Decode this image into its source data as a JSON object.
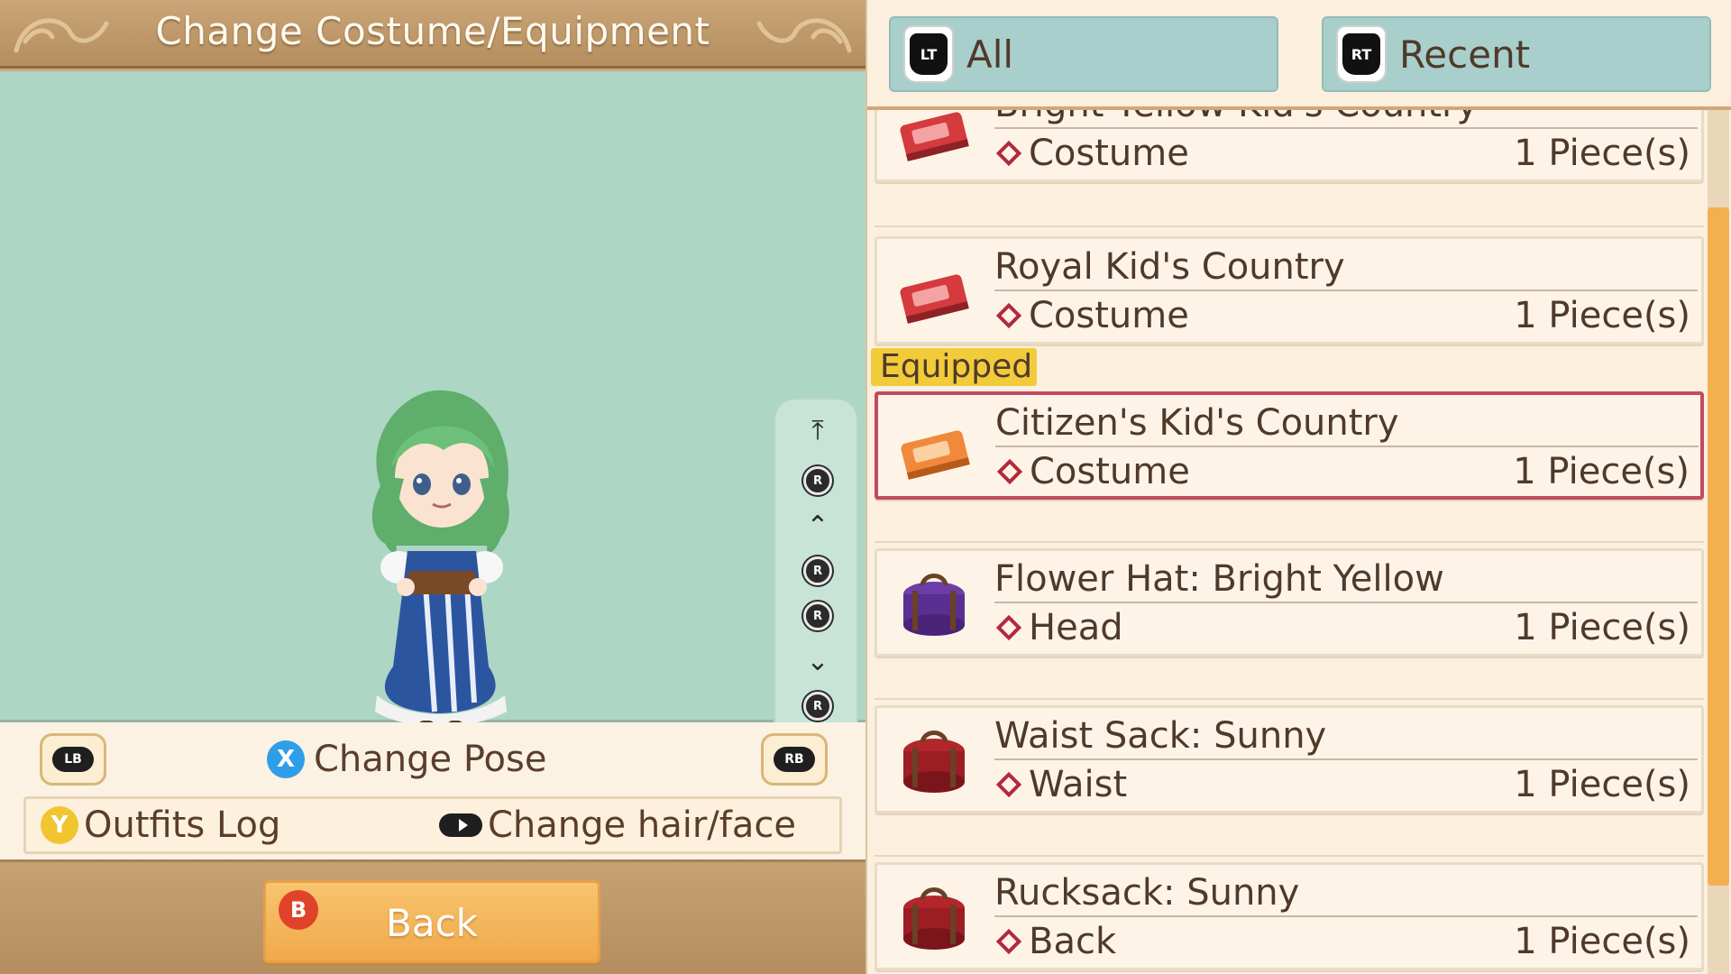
{
  "header": {
    "title": "Change Costume/Equipment"
  },
  "scroll_guide": {
    "r_label": "R"
  },
  "controls": {
    "lb_label": "LB",
    "rb_label": "RB",
    "x_label": "X",
    "change_pose": "Change Pose",
    "y_label": "Y",
    "outfits_log": "Outfits Log",
    "change_hair_face": "Change hair/face"
  },
  "footer": {
    "b_label": "B",
    "back": "Back"
  },
  "filters": [
    {
      "badge": "LT",
      "label": "All"
    },
    {
      "badge": "RT",
      "label": "Recent"
    }
  ],
  "equipped_label": "Equipped",
  "items": [
    {
      "name": "Bright Yellow Kid's Country",
      "category": "Costume",
      "quantity": "1 Piece(s)",
      "icon": "red-suitcase-icon"
    },
    {
      "name": "Royal Kid's Country",
      "category": "Costume",
      "quantity": "1 Piece(s)",
      "icon": "red-suitcase-icon"
    },
    {
      "name": "Citizen's Kid's Country",
      "category": "Costume",
      "quantity": "1 Piece(s)",
      "icon": "orange-suitcase-icon",
      "equipped": true
    },
    {
      "name": "Flower Hat: Bright Yellow",
      "category": "Head",
      "quantity": "1 Piece(s)",
      "icon": "purple-bag-icon"
    },
    {
      "name": "Waist Sack:  Sunny",
      "category": "Waist",
      "quantity": "1 Piece(s)",
      "icon": "red-bag-icon"
    },
    {
      "name": "Rucksack: Sunny",
      "category": "Back",
      "quantity": "1 Piece(s)",
      "icon": "red-bag-icon"
    }
  ],
  "colors": {
    "preview_bg": "#aed6c4",
    "equipped_border": "#c24a63",
    "equipped_tag": "#f2cb3a",
    "filter_tab": "#a8cfcc",
    "back_button": "#f0a94a"
  }
}
